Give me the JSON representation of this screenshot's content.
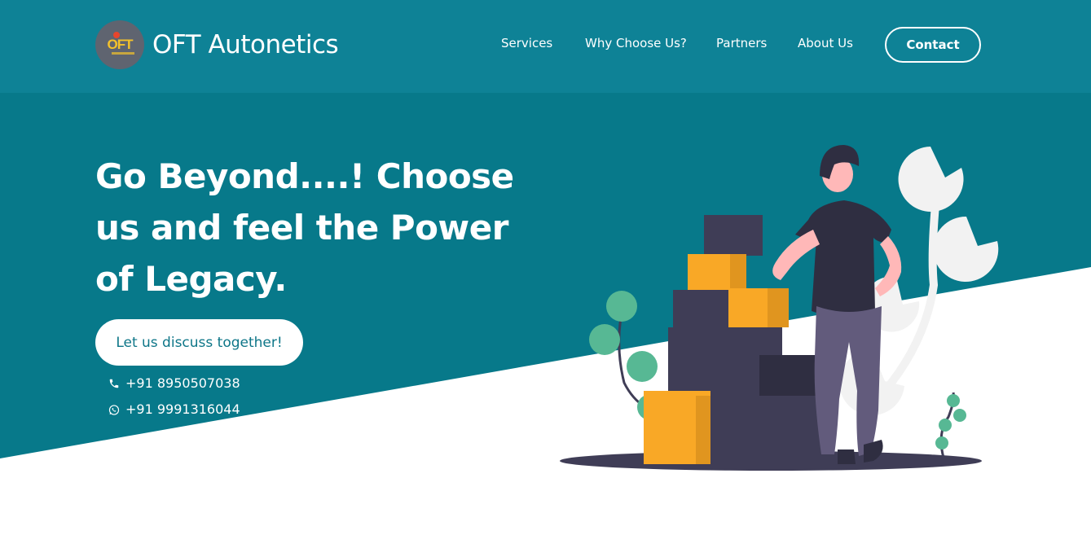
{
  "colors": {
    "header_bg": "#0e8296",
    "hero_bg": "#07798a",
    "white": "#ffffff",
    "accent_yellow": "#f9a826",
    "dark_box": "#3f3d56",
    "leaf_green": "#57b894"
  },
  "brand": {
    "logo_text": "OFT",
    "name": "OFT Autonetics"
  },
  "nav": {
    "items": [
      {
        "label": "Services"
      },
      {
        "label": "Why Choose Us?"
      },
      {
        "label": "Partners"
      },
      {
        "label": "About Us"
      }
    ],
    "contact_label": "Contact"
  },
  "hero": {
    "headline": "Go Beyond....! Choose us and feel the Power of Legacy.",
    "cta_label": "Let us discuss together!",
    "phone": "+91 8950507038",
    "whatsapp": "+91 9991316044",
    "phone_icon": "phone-icon",
    "whatsapp_icon": "whatsapp-icon"
  }
}
